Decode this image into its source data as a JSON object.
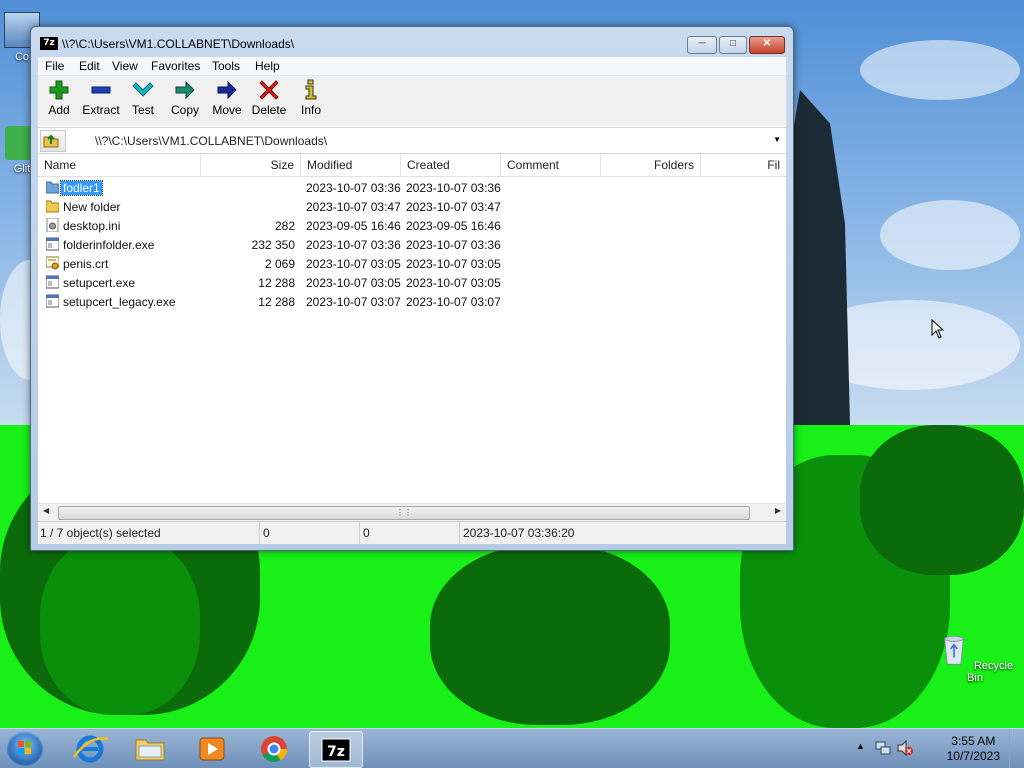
{
  "desktop": {
    "icons": [
      {
        "label": "Co"
      },
      {
        "label": "Glit"
      },
      {
        "label": "Recycle Bin"
      }
    ]
  },
  "window": {
    "title": "\\\\?\\C:\\Users\\VM1.COLLABNET\\Downloads\\",
    "logo_text": "7z",
    "menu": [
      "File",
      "Edit",
      "View",
      "Favorites",
      "Tools",
      "Help"
    ],
    "toolbar": [
      {
        "label": "Add",
        "icon": "plus-icon",
        "color": "#1f9a1f"
      },
      {
        "label": "Extract",
        "icon": "minus-icon",
        "color": "#1b3fb8"
      },
      {
        "label": "Test",
        "icon": "check-icon",
        "color": "#18b4c4"
      },
      {
        "label": "Copy",
        "icon": "arrow-right-icon",
        "color": "#1a8a6a"
      },
      {
        "label": "Move",
        "icon": "arrow-right-icon",
        "color": "#1a2a9a"
      },
      {
        "label": "Delete",
        "icon": "x-icon",
        "color": "#d81e1e"
      },
      {
        "label": "Info",
        "icon": "info-icon",
        "color": "#d8c21a"
      }
    ],
    "address": "\\\\?\\C:\\Users\\VM1.COLLABNET\\Downloads\\",
    "columns": [
      "Name",
      "Size",
      "Modified",
      "Created",
      "Comment",
      "Folders",
      "Fil"
    ],
    "files": [
      {
        "name": "fodler1",
        "size": "",
        "modified": "2023-10-07 03:36",
        "created": "2023-10-07 03:36",
        "type": "folder",
        "selected": true
      },
      {
        "name": "New folder",
        "size": "",
        "modified": "2023-10-07 03:47",
        "created": "2023-10-07 03:47",
        "type": "folder",
        "selected": false
      },
      {
        "name": "desktop.ini",
        "size": "282",
        "modified": "2023-09-05 16:46",
        "created": "2023-09-05 16:46",
        "type": "ini",
        "selected": false
      },
      {
        "name": "folderinfolder.exe",
        "size": "232 350",
        "modified": "2023-10-07 03:36",
        "created": "2023-10-07 03:36",
        "type": "exe",
        "selected": false
      },
      {
        "name": "penis.crt",
        "size": "2 069",
        "modified": "2023-10-07 03:05",
        "created": "2023-10-07 03:05",
        "type": "crt",
        "selected": false
      },
      {
        "name": "setupcert.exe",
        "size": "12 288",
        "modified": "2023-10-07 03:05",
        "created": "2023-10-07 03:05",
        "type": "exe",
        "selected": false
      },
      {
        "name": "setupcert_legacy.exe",
        "size": "12 288",
        "modified": "2023-10-07 03:07",
        "created": "2023-10-07 03:07",
        "type": "exe",
        "selected": false
      }
    ],
    "status": {
      "selection": "1 / 7 object(s) selected",
      "size": "0",
      "packed": "0",
      "modified": "2023-10-07 03:36:20"
    }
  },
  "taskbar": {
    "apps": [
      "internet-explorer",
      "file-explorer",
      "media-player",
      "chrome",
      "7-zip"
    ],
    "time": "3:55 AM",
    "date": "10/7/2023"
  }
}
